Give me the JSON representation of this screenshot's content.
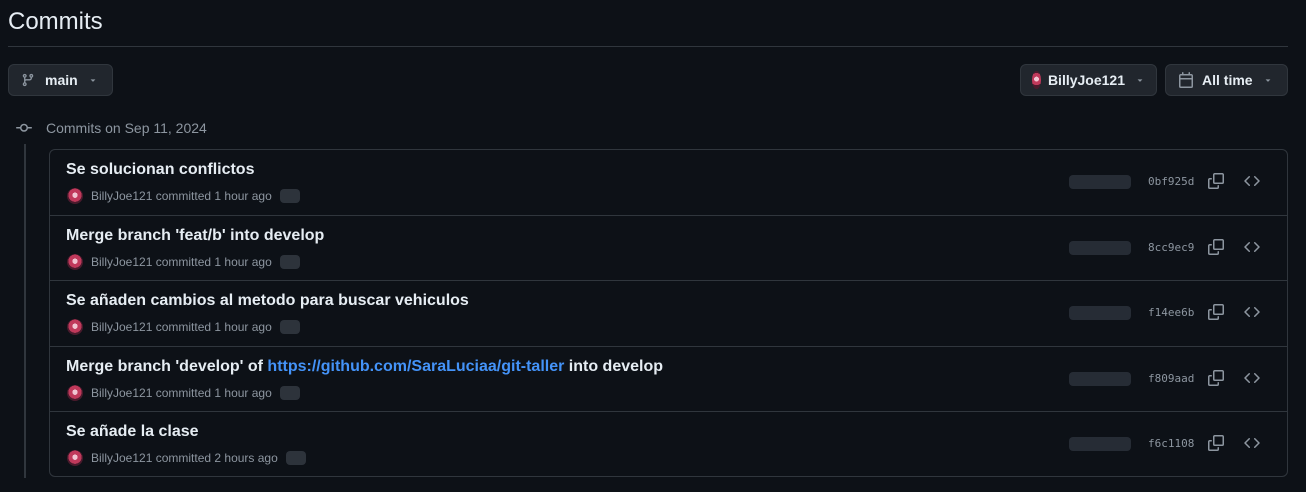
{
  "header": {
    "title": "Commits"
  },
  "toolbar": {
    "branch_label": "main",
    "author_label": "BillyJoe121",
    "time_label": "All time"
  },
  "group": {
    "date_label": "Commits on Sep 11, 2024"
  },
  "commits": [
    {
      "message": "Se solucionan conflictos",
      "author": "BillyJoe121",
      "meta_text": "committed 1 hour ago",
      "sha": "0bf925d"
    },
    {
      "message": "Merge branch 'feat/b' into develop",
      "author": "BillyJoe121",
      "meta_text": "committed 1 hour ago",
      "sha": "8cc9ec9"
    },
    {
      "message": "Se añaden cambios al metodo para buscar vehiculos",
      "author": "BillyJoe121",
      "meta_text": "committed 1 hour ago",
      "sha": "f14ee6b"
    },
    {
      "message_prefix": "Merge branch 'develop' of ",
      "message_link": "https://github.com/SaraLuciaa/git-taller",
      "message_suffix": " into develop",
      "author": "BillyJoe121",
      "meta_text": "committed 1 hour ago",
      "sha": "f809aad"
    },
    {
      "message": "Se añade la clase",
      "author": "BillyJoe121",
      "meta_text": "committed 2 hours ago",
      "sha": "f6c1108"
    }
  ],
  "colors": {
    "background": "#0d1117",
    "border": "#30363d",
    "text": "#e6edf3",
    "muted": "#8d96a0",
    "link": "#4493f8"
  },
  "icons": {
    "branch": "git-branch-icon",
    "caret": "triangle-down-icon",
    "calendar": "calendar-icon",
    "commit": "git-commit-icon",
    "copy": "copy-icon",
    "browse": "code-icon"
  }
}
